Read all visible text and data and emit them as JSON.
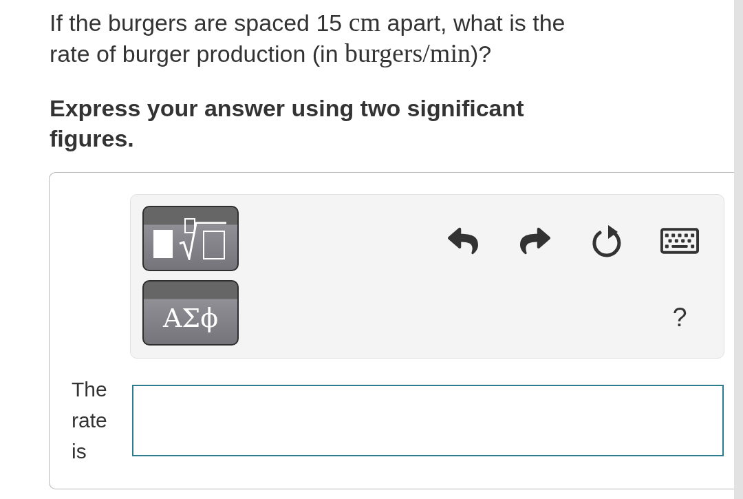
{
  "question": {
    "segments": [
      {
        "kind": "text",
        "text": "If the burgers are spaced 15 "
      },
      {
        "kind": "math",
        "text": "cm"
      },
      {
        "kind": "text",
        "text": " apart, what is the rate of burger production (in "
      },
      {
        "kind": "math",
        "text": "burgers/min"
      },
      {
        "kind": "text",
        "text": ")?"
      }
    ]
  },
  "instruction": "Express your answer using two significant figures.",
  "answer_panel": {
    "toolbar": {
      "template_buttons": [
        {
          "kind": "templates"
        },
        {
          "kind": "symbols",
          "label": "ΑΣϕ"
        }
      ],
      "actions": [
        {
          "kind": "undo"
        },
        {
          "kind": "redo"
        },
        {
          "kind": "reset"
        },
        {
          "kind": "keyboard"
        }
      ],
      "help": "?"
    },
    "answer_label": "The rate is"
  }
}
